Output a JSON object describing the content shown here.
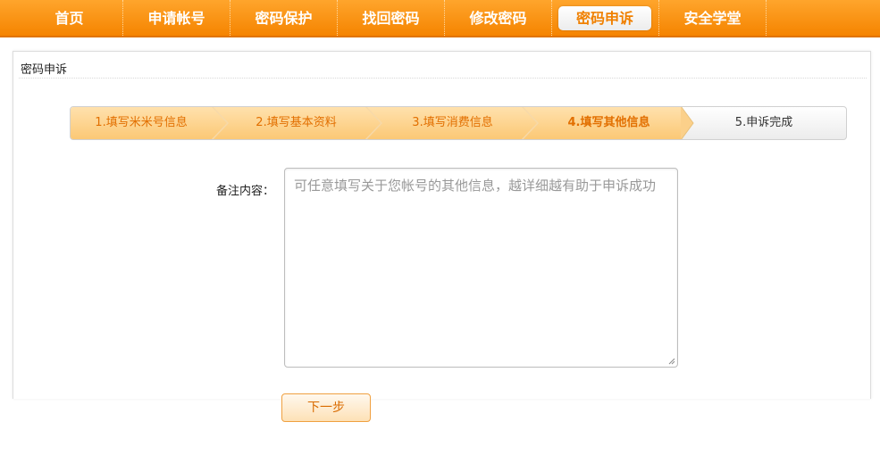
{
  "nav": {
    "items": [
      {
        "label": "首页"
      },
      {
        "label": "申请帐号"
      },
      {
        "label": "密码保护"
      },
      {
        "label": "找回密码"
      },
      {
        "label": "修改密码"
      },
      {
        "label": "密码申诉",
        "active": true
      },
      {
        "label": "安全学堂"
      }
    ]
  },
  "panel": {
    "title": "密码申诉"
  },
  "steps": [
    {
      "label": "1.填写米米号信息"
    },
    {
      "label": "2.填写基本资料"
    },
    {
      "label": "3.填写消费信息"
    },
    {
      "label": "4.填写其他信息"
    },
    {
      "label": "5.申诉完成"
    }
  ],
  "form": {
    "remark_label": "备注内容：",
    "remark_placeholder": "可任意填写关于您帐号的其他信息，越详细越有助于申诉成功",
    "next_label": "下一步"
  },
  "colors": {
    "nav_bg": "#f58400",
    "accent_text": "#e26f00",
    "step_done_bg": "#fbc875"
  }
}
